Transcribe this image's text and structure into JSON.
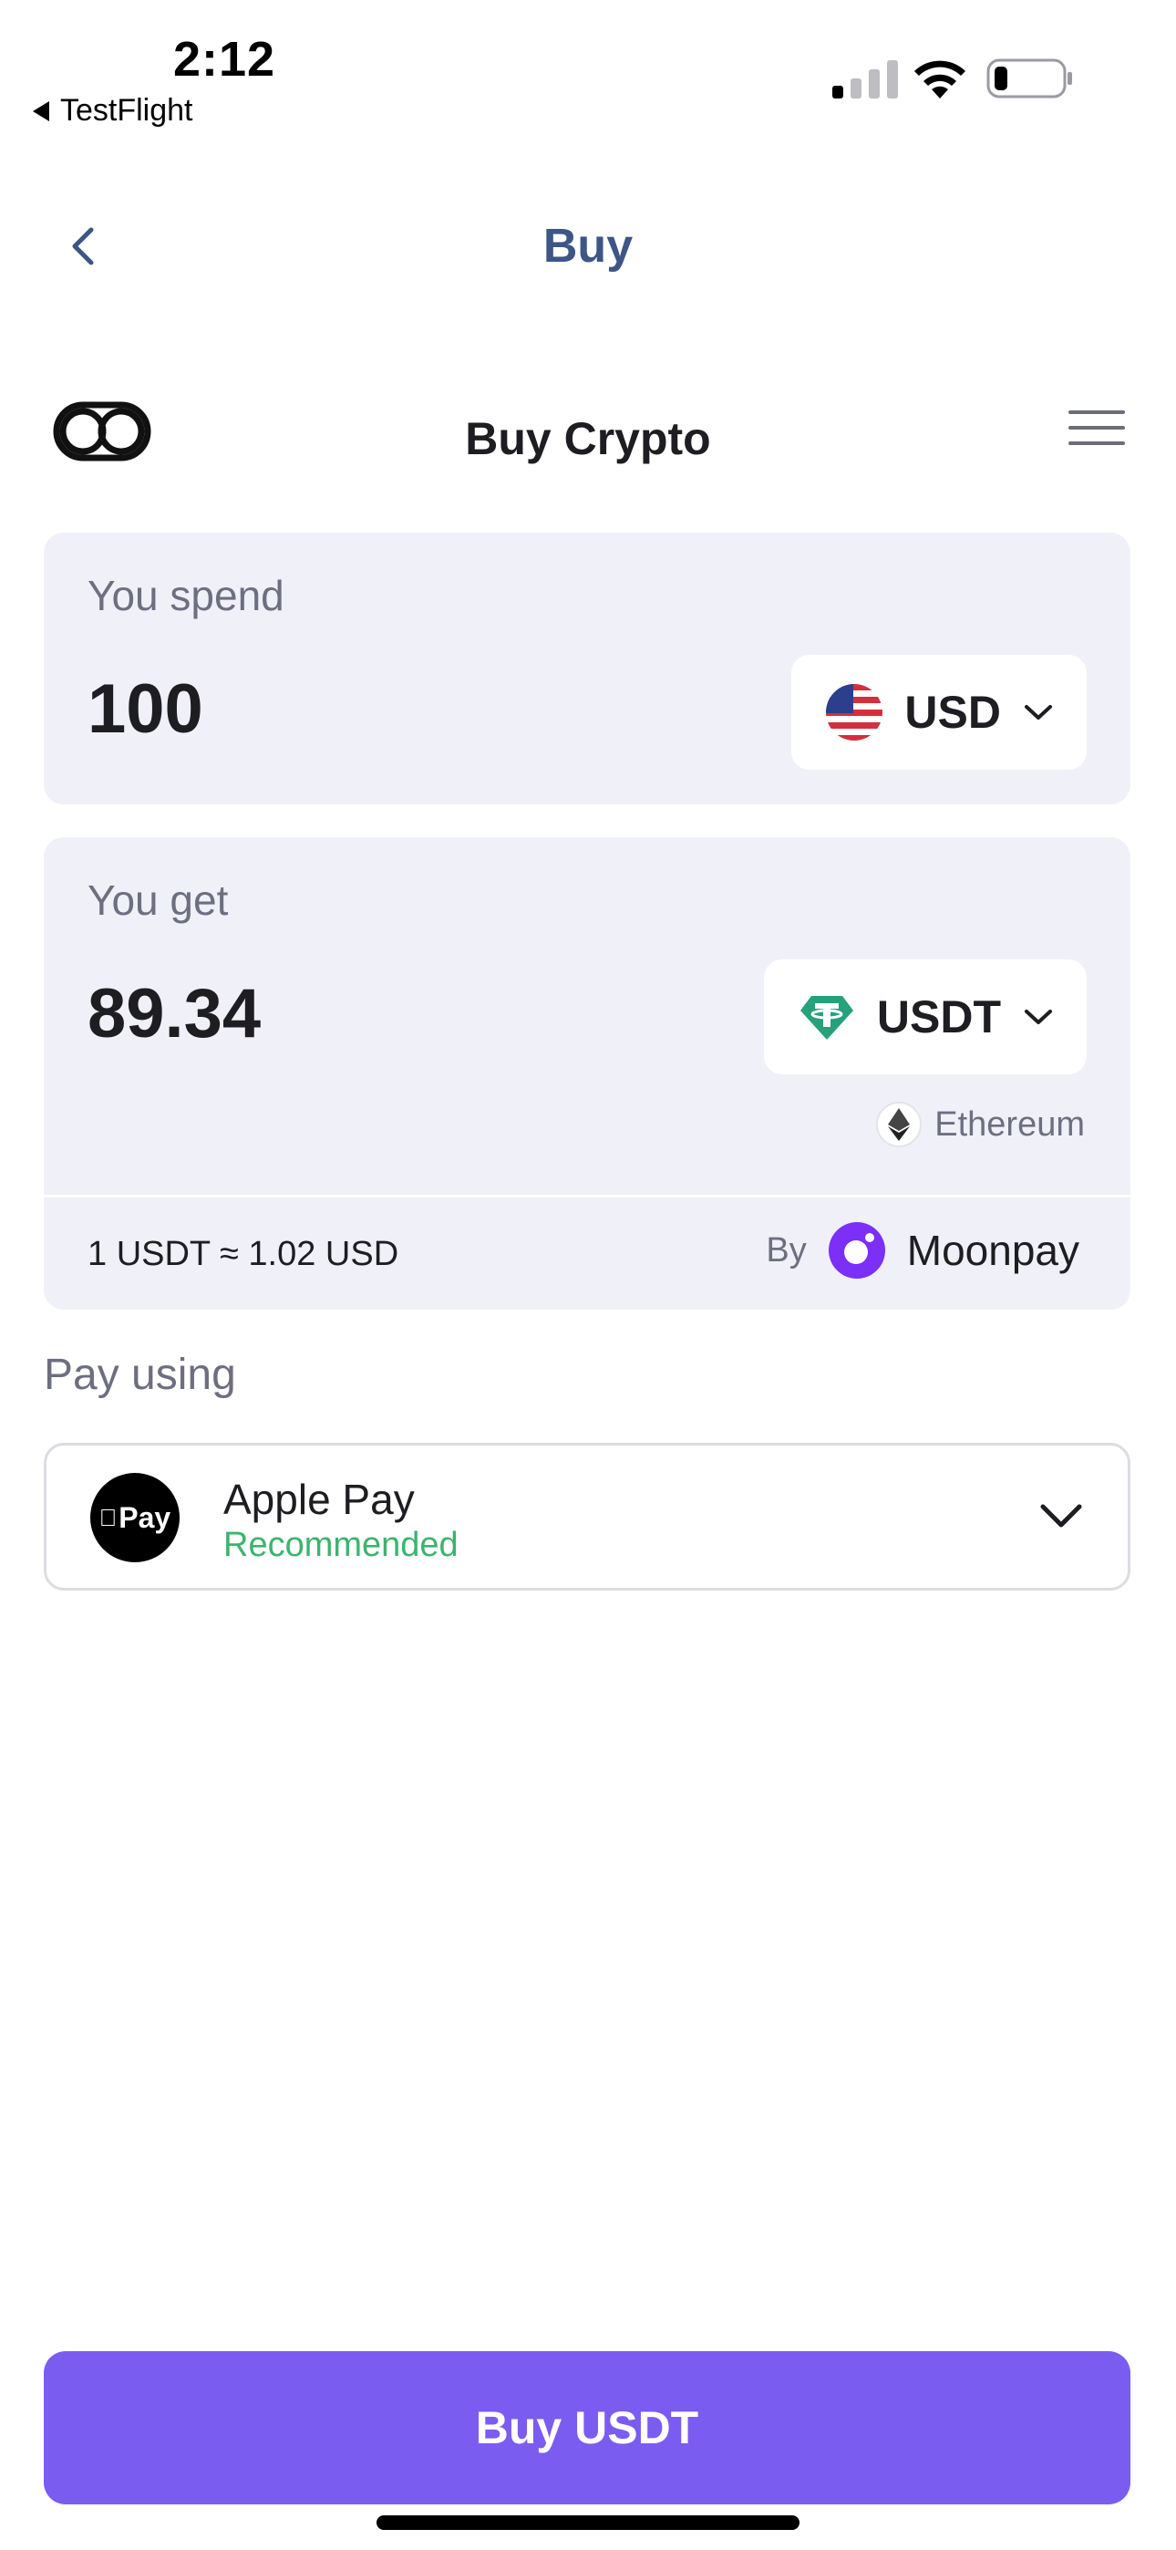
{
  "status_bar": {
    "time": "2:12",
    "back_app": "TestFlight",
    "icons": [
      "cellular-signal-icon",
      "wifi-icon",
      "battery-icon"
    ]
  },
  "nav": {
    "title": "Buy",
    "back_icon": "chevron-left-icon"
  },
  "widget": {
    "title": "Buy Crypto",
    "logo_icon": "brand-logo-icon",
    "menu_icon": "hamburger-menu-icon"
  },
  "spend": {
    "label": "You spend",
    "amount": "100",
    "currency": "USD",
    "currency_icon": "us-flag-icon"
  },
  "get": {
    "label": "You get",
    "amount": "89.34",
    "currency": "USDT",
    "currency_icon": "tether-icon",
    "network": "Ethereum",
    "network_icon": "ethereum-icon"
  },
  "quote": {
    "rate": "1 USDT ≈ 1.02 USD",
    "by_label": "By",
    "provider": "Moonpay",
    "provider_icon": "moonpay-logo-icon"
  },
  "payment": {
    "label": "Pay using",
    "method": "Apple Pay",
    "method_icon_text": "Pay",
    "badge": "Recommended"
  },
  "cta": {
    "label": "Buy USDT"
  },
  "colors": {
    "accent": "#7b5cf0",
    "nav_title": "#3d5686",
    "card_bg": "#f0f0f8",
    "recommended": "#3cb46e",
    "moonpay": "#7b2ff7",
    "tether": "#26a17b"
  }
}
